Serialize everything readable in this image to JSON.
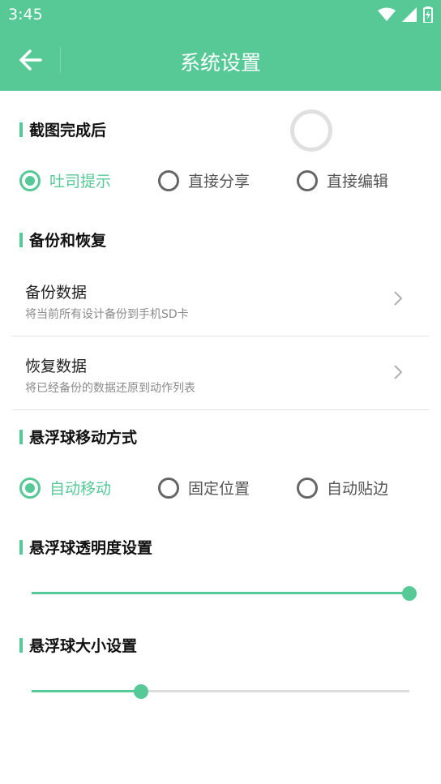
{
  "status_bar": {
    "time": "3:45"
  },
  "app_bar": {
    "title": "系统设置"
  },
  "screenshot_section": {
    "title": "截图完成后",
    "options": [
      "吐司提示",
      "直接分享",
      "直接编辑"
    ],
    "selected": "吐司提示"
  },
  "backup_section": {
    "title": "备份和恢复",
    "items": [
      {
        "title": "备份数据",
        "subtitle": "将当前所有设计备份到手机SD卡"
      },
      {
        "title": "恢复数据",
        "subtitle": "将已经备份的数据还原到动作列表"
      }
    ]
  },
  "float_move_section": {
    "title": "悬浮球移动方式",
    "options": [
      "自动移动",
      "固定位置",
      "自动贴边"
    ],
    "selected": "自动移动"
  },
  "opacity_section": {
    "title": "悬浮球透明度设置",
    "value": 1.0
  },
  "size_section": {
    "title": "悬浮球大小设置",
    "value": 0.29
  },
  "colors": {
    "accent": "#56c997"
  }
}
